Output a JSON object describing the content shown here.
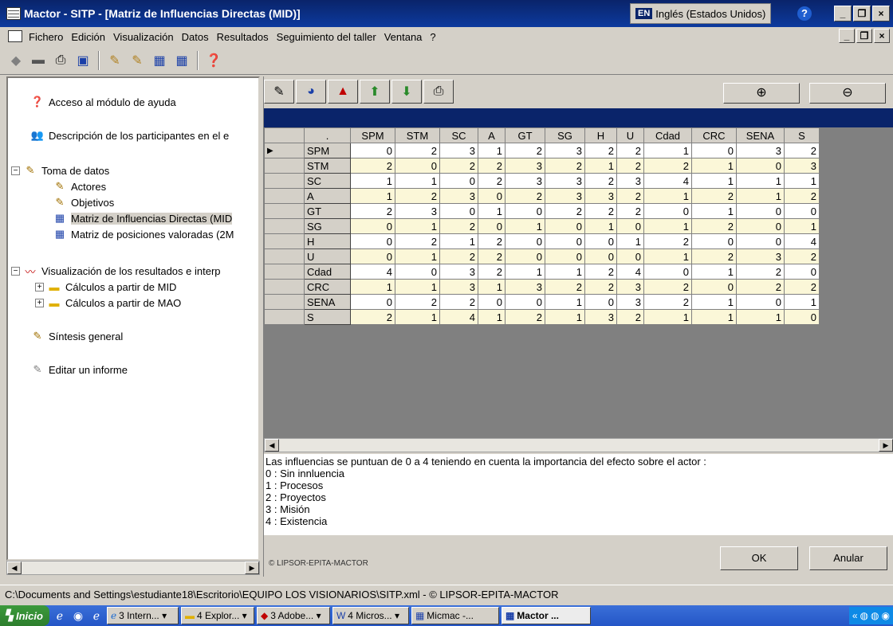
{
  "window": {
    "title": "Mactor  -  SITP - [Matriz de Influencias Directas (MID)]",
    "lang_code": "EN",
    "lang_label": "Inglés (Estados Unidos)",
    "help_symbol": "?",
    "min": "_",
    "max": "❐",
    "close": "×"
  },
  "menu": [
    "Fichero",
    "Edición",
    "Visualización",
    "Datos",
    "Resultados",
    "Seguimiento del taller",
    "Ventana",
    "?"
  ],
  "tree": {
    "help": "Acceso al módulo de ayuda",
    "participants": "Descripción de los participantes en el e",
    "data": "Toma de datos",
    "actors": "Actores",
    "objectives": "Objetivos",
    "mid": "Matriz de Influencias Directas (MID",
    "mao": "Matriz de posiciones valoradas (2M",
    "results": "Visualización de los resultados e interp",
    "calc_mid": "Cálculos a partir de MID",
    "calc_mao": "Cálculos a partir de MAO",
    "synthesis": "Síntesis general",
    "report": "Editar un informe",
    "expander_minus": "−",
    "expander_plus": "+"
  },
  "matrix": {
    "corner": ".",
    "columns": [
      "SPM",
      "STM",
      "SC",
      "A",
      "GT",
      "SG",
      "H",
      "U",
      "Cdad",
      "CRC",
      "SENA",
      "S"
    ],
    "rows": [
      {
        "label": "SPM",
        "values": [
          0,
          2,
          3,
          1,
          2,
          3,
          2,
          2,
          1,
          0,
          3,
          2
        ]
      },
      {
        "label": "STM",
        "values": [
          2,
          0,
          2,
          2,
          3,
          2,
          1,
          2,
          2,
          1,
          0,
          3
        ]
      },
      {
        "label": "SC",
        "values": [
          1,
          1,
          0,
          2,
          3,
          3,
          2,
          3,
          4,
          1,
          1,
          1
        ]
      },
      {
        "label": "A",
        "values": [
          1,
          2,
          3,
          0,
          2,
          3,
          3,
          2,
          1,
          2,
          1,
          2
        ]
      },
      {
        "label": "GT",
        "values": [
          2,
          3,
          0,
          1,
          0,
          2,
          2,
          2,
          0,
          1,
          0,
          0
        ]
      },
      {
        "label": "SG",
        "values": [
          0,
          1,
          2,
          0,
          1,
          0,
          1,
          0,
          1,
          2,
          0,
          1
        ]
      },
      {
        "label": "H",
        "values": [
          0,
          2,
          1,
          2,
          0,
          0,
          0,
          1,
          2,
          0,
          0,
          4
        ]
      },
      {
        "label": "U",
        "values": [
          0,
          1,
          2,
          2,
          0,
          0,
          0,
          0,
          1,
          2,
          3,
          2
        ]
      },
      {
        "label": "Cdad",
        "values": [
          4,
          0,
          3,
          2,
          1,
          1,
          2,
          4,
          0,
          1,
          2,
          0
        ]
      },
      {
        "label": "CRC",
        "values": [
          1,
          1,
          3,
          1,
          3,
          2,
          2,
          3,
          2,
          0,
          2,
          2
        ]
      },
      {
        "label": "SENA",
        "values": [
          0,
          2,
          2,
          0,
          0,
          1,
          0,
          3,
          2,
          1,
          0,
          1
        ]
      },
      {
        "label": "S",
        "values": [
          2,
          1,
          4,
          1,
          2,
          1,
          3,
          2,
          1,
          1,
          1,
          0
        ]
      }
    ],
    "current_row_marker": "▶"
  },
  "legend": {
    "intro": "Las influencias se puntuan de 0 a 4 teniendo en cuenta la importancia del efecto sobre el actor :",
    "items": [
      "0 : Sin innluencia",
      "1 : Procesos",
      "2 : Proyectos",
      "3 : Misión",
      "4 : Existencia"
    ]
  },
  "credit": "© LIPSOR-EPITA-MACTOR",
  "buttons": {
    "ok": "OK",
    "cancel": "Anular"
  },
  "status": "C:\\Documents and Settings\\estudiante18\\Escritorio\\EQUIPO LOS VISIONARIOS\\SITP.xml  - © LIPSOR-EPITA-MACTOR",
  "taskbar": {
    "start": "Inicio",
    "tasks": [
      "3 Intern... ▾",
      "4 Explor... ▾",
      "3 Adobe... ▾",
      "4 Micros... ▾",
      "Micmac  -...",
      "Mactor  ..."
    ],
    "tray_chevron": "«"
  },
  "zoom": {
    "in": "⊕",
    "out": "⊖"
  }
}
